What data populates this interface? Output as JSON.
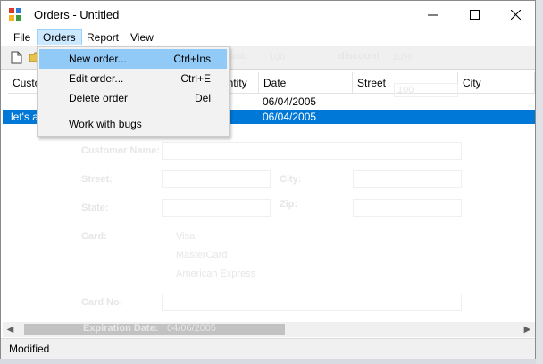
{
  "window": {
    "title": "Orders - Untitled"
  },
  "title_buttons": {
    "minimize": "—",
    "maximize": "☐",
    "close": "✕"
  },
  "menu": {
    "items": [
      "File",
      "Orders",
      "Report",
      "View"
    ]
  },
  "dropdown": {
    "items": [
      {
        "label": "New order...",
        "shortcut": "Ctrl+Ins"
      },
      {
        "label": "Edit order...",
        "shortcut": "Ctrl+E"
      },
      {
        "label": "Delete order",
        "shortcut": "Del"
      },
      {
        "label": "Work with bugs",
        "shortcut": ""
      }
    ]
  },
  "grid": {
    "headers": [
      "Custo",
      "antity",
      "Date",
      "Street",
      "City"
    ],
    "rows": [
      {
        "customer": "",
        "date": "06/04/2005"
      },
      {
        "customer": "let's a",
        "date": "06/04/2005"
      }
    ]
  },
  "background_form": {
    "labels": [
      "Customer Name:",
      "Street:",
      "City:",
      "State:",
      "Zip:",
      "Card:",
      "Card No:",
      "Expiration Date:"
    ],
    "radio_options": [
      "Visa",
      "MasterCard",
      "American Express"
    ],
    "top_labels": [
      "unt:",
      "discount"
    ],
    "top_values": [
      "100",
      "10%",
      "100"
    ],
    "expiration_value": "04/06/2005"
  },
  "status": {
    "text": "Modified"
  },
  "colors": {
    "selection": "#0078d7",
    "menu_highlight": "#91c9f7",
    "menu_active": "#cce8ff"
  }
}
